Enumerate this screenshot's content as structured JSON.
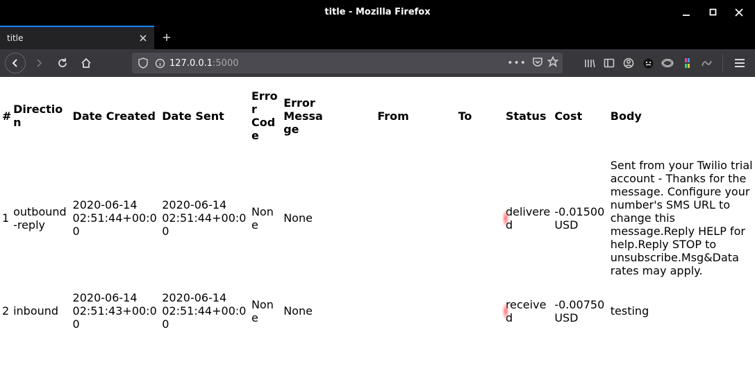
{
  "window": {
    "title": "title - Mozilla Firefox"
  },
  "tab": {
    "label": "title"
  },
  "url": {
    "host": "127.0.0.1",
    "path": ":5000"
  },
  "table": {
    "headers": {
      "num": "#",
      "direction": "Direction",
      "date_created": "Date Created",
      "date_sent": "Date Sent",
      "error_code": "Error Code",
      "error_message": "Error Message",
      "from": "From",
      "to": "To",
      "status": "Status",
      "cost": "Cost",
      "body": "Body"
    },
    "rows": [
      {
        "num": "1",
        "direction": "outbound-reply",
        "date_created": "2020-06-14 02:51:44+00:00",
        "date_sent": "2020-06-14 02:51:44+00:00",
        "error_code": "None",
        "error_message": "None",
        "from": "",
        "to": "",
        "status": "delivered",
        "cost": "-0.01500 USD",
        "body": "Sent from your Twilio trial account - Thanks for the message. Configure your number's SMS URL to change this message.Reply HELP for help.Reply STOP to unsubscribe.Msg&Data rates may apply."
      },
      {
        "num": "2",
        "direction": "inbound",
        "date_created": "2020-06-14 02:51:43+00:00",
        "date_sent": "2020-06-14 02:51:44+00:00",
        "error_code": "None",
        "error_message": "None",
        "from": "",
        "to": "",
        "status": "received",
        "cost": "-0.00750 USD",
        "body": "testing"
      }
    ]
  }
}
